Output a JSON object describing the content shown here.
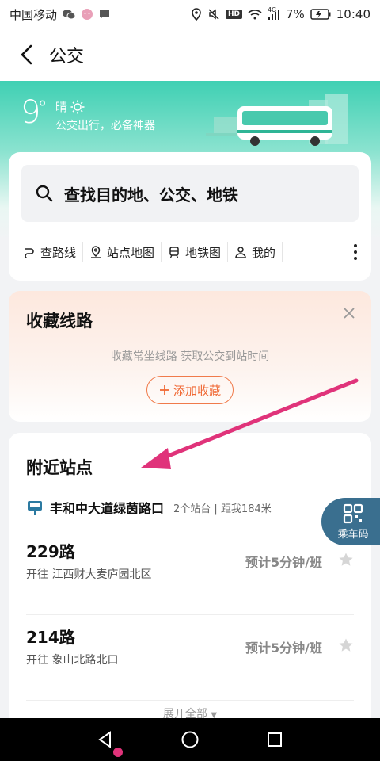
{
  "status_bar": {
    "carrier": "中国移动",
    "battery": "7%",
    "time": "10:40",
    "hd": "HD",
    "network": "4G",
    "icons": [
      "wechat-icon",
      "app-icon",
      "chat-icon",
      "location-icon",
      "mute-icon",
      "wifi-icon",
      "signal-icon",
      "battery-icon"
    ]
  },
  "header": {
    "title": "公交"
  },
  "weather": {
    "temperature": "9",
    "degree": "°",
    "condition": "晴",
    "slogan": "公交出行，必备神器"
  },
  "search": {
    "placeholder": "查找目的地、公交、地铁"
  },
  "quick_actions": [
    {
      "label": "查路线",
      "icon": "route-icon"
    },
    {
      "label": "站点地图",
      "icon": "map-pin-icon"
    },
    {
      "label": "地铁图",
      "icon": "subway-icon"
    },
    {
      "label": "我的",
      "icon": "user-icon"
    }
  ],
  "favorites": {
    "title": "收藏线路",
    "description": "收藏常坐线路 获取公交到站时间",
    "add_button": "添加收藏"
  },
  "nearby": {
    "title": "附近站点",
    "station": {
      "name": "丰和中大道绿茵路口",
      "meta": "2个站台 | 距我184米"
    },
    "routes": [
      {
        "name": "229路",
        "direction": "开往 江西财大麦庐园北区",
        "eta": "预计5分钟/班"
      },
      {
        "name": "214路",
        "direction": "开往 象山北路北口",
        "eta": "预计5分钟/班"
      }
    ],
    "expand_label": "展开全部"
  },
  "ride_code": {
    "label": "乘车码"
  },
  "colors": {
    "accent_teal": "#3fd0b3",
    "accent_orange": "#f06a36",
    "arrow_pink": "#e0337a",
    "ride_code_bg": "#3a6f8f"
  }
}
